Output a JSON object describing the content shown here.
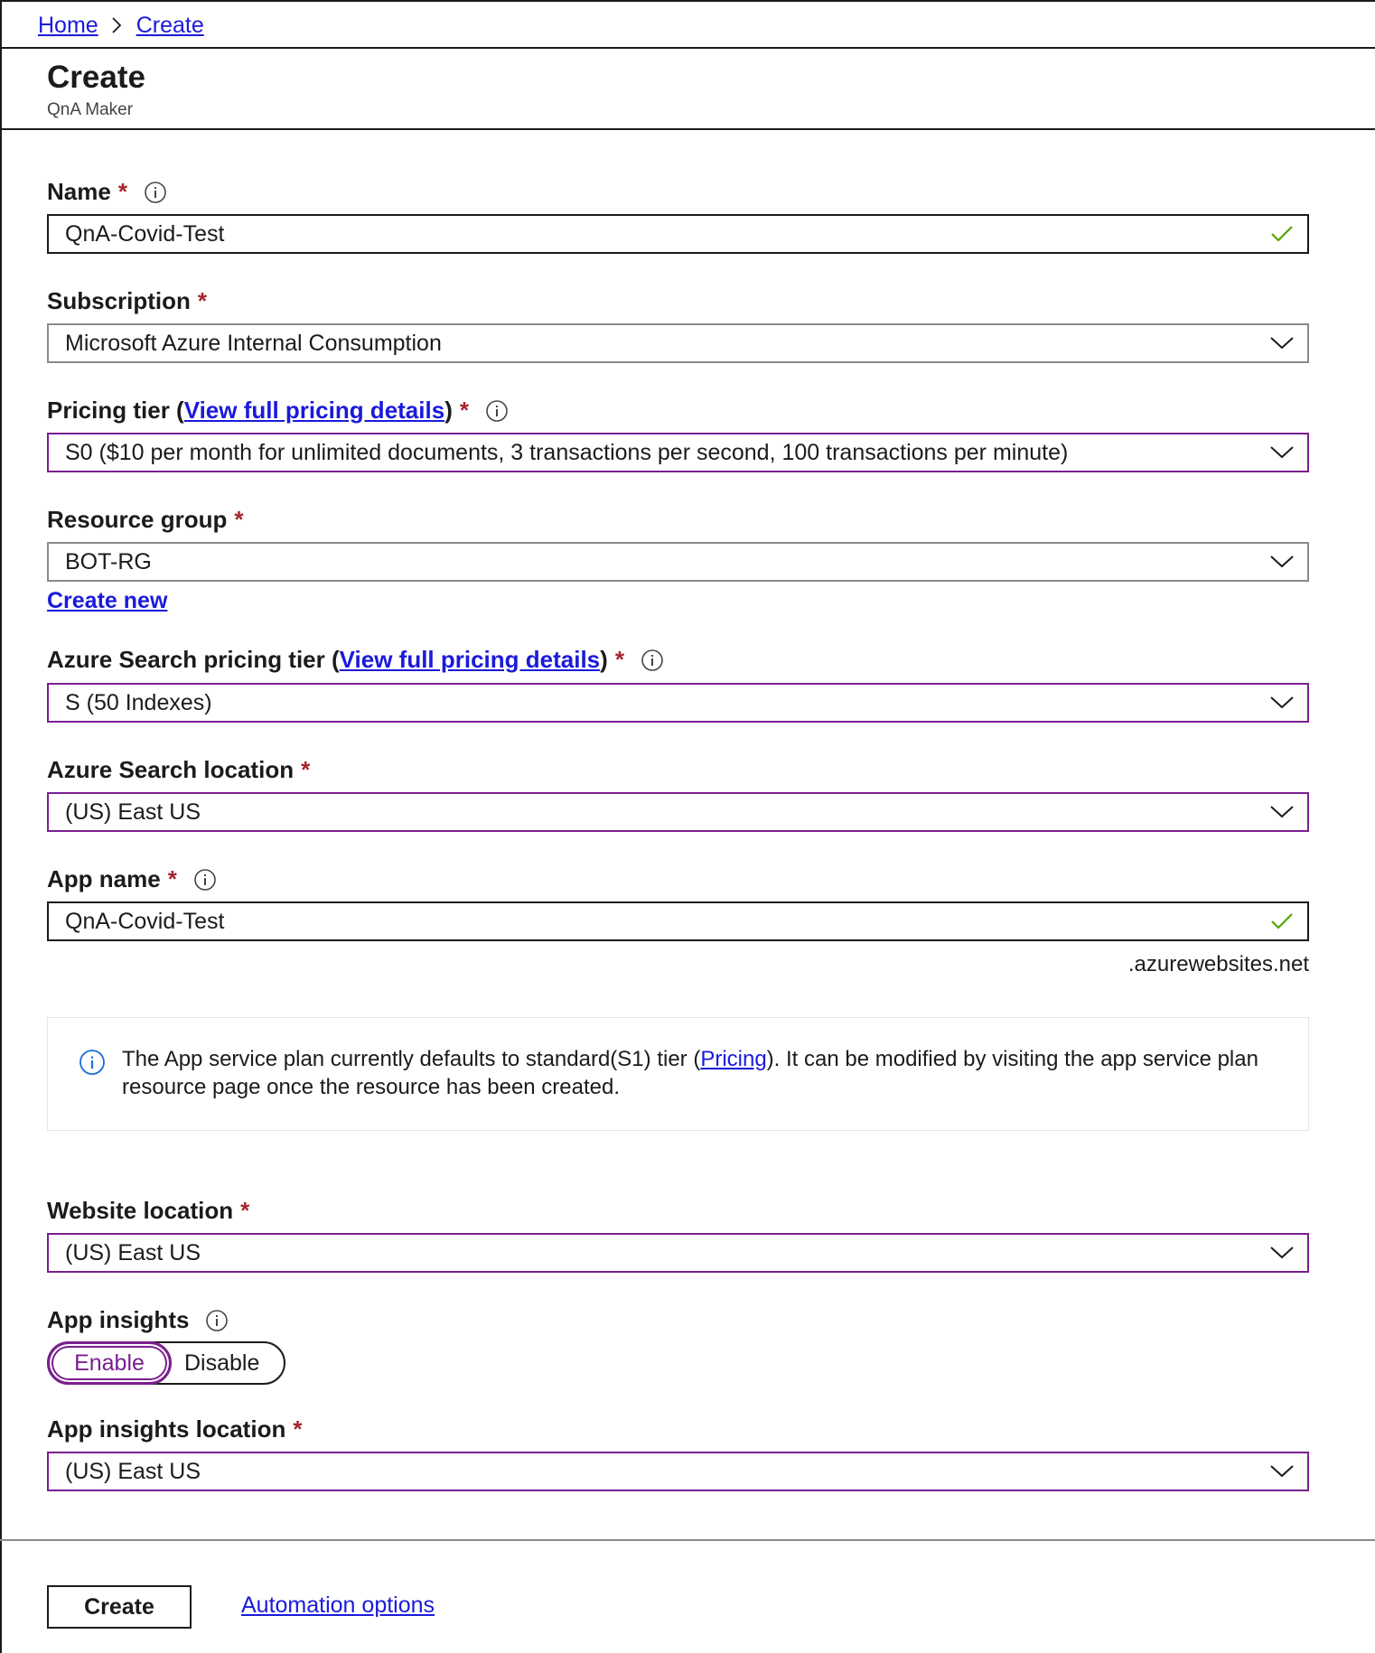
{
  "breadcrumb": {
    "home": "Home",
    "create": "Create"
  },
  "header": {
    "title": "Create",
    "subtitle": "QnA Maker"
  },
  "required_mark": "*",
  "form": {
    "name": {
      "label": "Name",
      "value": "QnA-Covid-Test"
    },
    "subscription": {
      "label": "Subscription",
      "value": "Microsoft Azure Internal Consumption"
    },
    "pricing_tier": {
      "label": "Pricing tier (",
      "link": "View full pricing details",
      "label_end": ")",
      "value": "S0 ($10 per month for unlimited documents, 3 transactions per second, 100 transactions per minute)"
    },
    "resource_group": {
      "label": "Resource group",
      "value": "BOT-RG",
      "create_new": "Create new"
    },
    "search_pricing_tier": {
      "label": "Azure Search pricing tier (",
      "link": "View full pricing details",
      "label_end": ")",
      "value": "S (50 Indexes)"
    },
    "search_location": {
      "label": "Azure Search location",
      "value": "(US) East US"
    },
    "app_name": {
      "label": "App name",
      "value": "QnA-Covid-Test",
      "suffix": ".azurewebsites.net"
    },
    "info": {
      "text_before": "The App service plan currently defaults to standard(S1) tier (",
      "link": "Pricing",
      "text_after": "). It can be modified by visiting the app service plan resource page once the resource has been created."
    },
    "website_location": {
      "label": "Website location",
      "value": "(US) East US"
    },
    "app_insights": {
      "label": "App insights",
      "enable": "Enable",
      "disable": "Disable",
      "selected": "Enable"
    },
    "app_insights_location": {
      "label": "App insights location",
      "value": "(US) East US"
    }
  },
  "footer": {
    "create": "Create",
    "automation": "Automation options"
  },
  "colors": {
    "accent": "#7a1f8f",
    "link": "#1a1adb",
    "required": "#a4262c",
    "valid": "#57a300"
  }
}
